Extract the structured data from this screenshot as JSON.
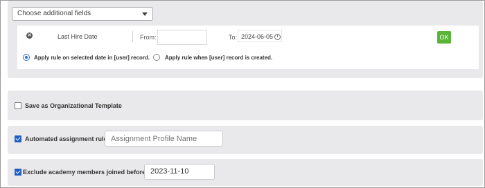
{
  "fields_select": {
    "label": "Choose additional fields"
  },
  "rule": {
    "field_name": "Last Hire Date",
    "from_label": "From:",
    "from_value": "",
    "to_label": "To:",
    "to_value": "2024-06-05",
    "ok_label": "OK",
    "options": [
      {
        "label": "Apply rule on selected date in [user] record.",
        "selected": true
      },
      {
        "label": "Apply rule when [user] record is created.",
        "selected": false
      }
    ]
  },
  "org_template": {
    "label": "Save as Organizational Template",
    "checked": false
  },
  "auto_assign": {
    "label": "Automated assignment rule",
    "checked": true,
    "placeholder": "Assignment Profile Name",
    "value": ""
  },
  "exclude_members": {
    "label": "Exclude academy members joined before",
    "checked": true,
    "value": "2023-11-10"
  },
  "colors": {
    "ok_button": "#59b438",
    "checkbox": "#1f5fc4",
    "panel": "#e9e9eb"
  },
  "icons": {
    "remove": "close-circle-icon",
    "info": "info-icon",
    "caret": "chevron-down-icon"
  }
}
